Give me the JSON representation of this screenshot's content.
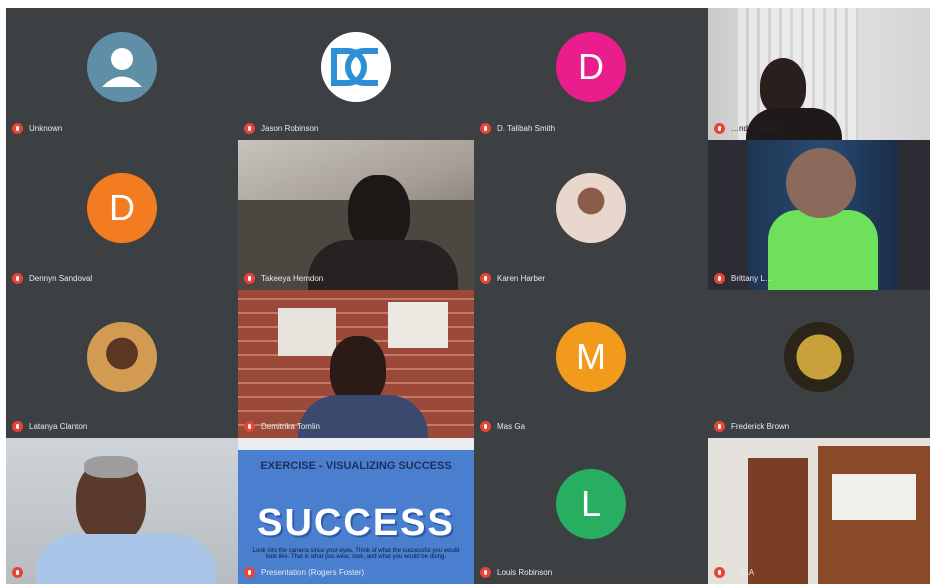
{
  "participants": [
    {
      "name": "Unknown",
      "initial": "",
      "avatar_color": "#5f8fa6"
    },
    {
      "name": "Jason Robinson",
      "initial": "",
      "avatar_color": "#2d8fd6"
    },
    {
      "name": "D. Talibah Smith",
      "initial": "D",
      "avatar_color": "#e91e8c"
    },
    {
      "name": "…ndra Nickson",
      "initial": "",
      "avatar_color": ""
    },
    {
      "name": "Dennyn Sandoval",
      "initial": "D",
      "avatar_color": "#f47c20"
    },
    {
      "name": "Takeeya Hemdon",
      "initial": "",
      "avatar_color": ""
    },
    {
      "name": "Karen Harber",
      "initial": "",
      "avatar_color": "#c88f7a"
    },
    {
      "name": "Brittany L…",
      "initial": "",
      "avatar_color": ""
    },
    {
      "name": "Latanya Clanton",
      "initial": "",
      "avatar_color": "#8a5a3c"
    },
    {
      "name": "Demitrika Tomlin",
      "initial": "",
      "avatar_color": ""
    },
    {
      "name": "Mas Ga",
      "initial": "M",
      "avatar_color": "#f29a1c"
    },
    {
      "name": "Frederick Brown",
      "initial": "",
      "avatar_color": "#c8a13a"
    },
    {
      "name": "",
      "initial": "",
      "avatar_color": ""
    },
    {
      "name": "Presentation (Rogers Foster)",
      "initial": "",
      "avatar_color": ""
    },
    {
      "name": "Louis Robinson",
      "initial": "L",
      "avatar_color": "#27ae60"
    },
    {
      "name": "…ELA",
      "initial": "",
      "avatar_color": ""
    }
  ],
  "presentation": {
    "title": "EXERCISE - VISUALIZING SUCCESS",
    "big_word": "SUCCESS",
    "caption": "Look into the camera since your eyes. Think of what the successful you would look like. That is what you wear, look, and what you would be doing."
  },
  "colors": {
    "background": "#2d2e31",
    "mic_muted": "#ea4335",
    "slide_bg": "#4a7fd0"
  }
}
